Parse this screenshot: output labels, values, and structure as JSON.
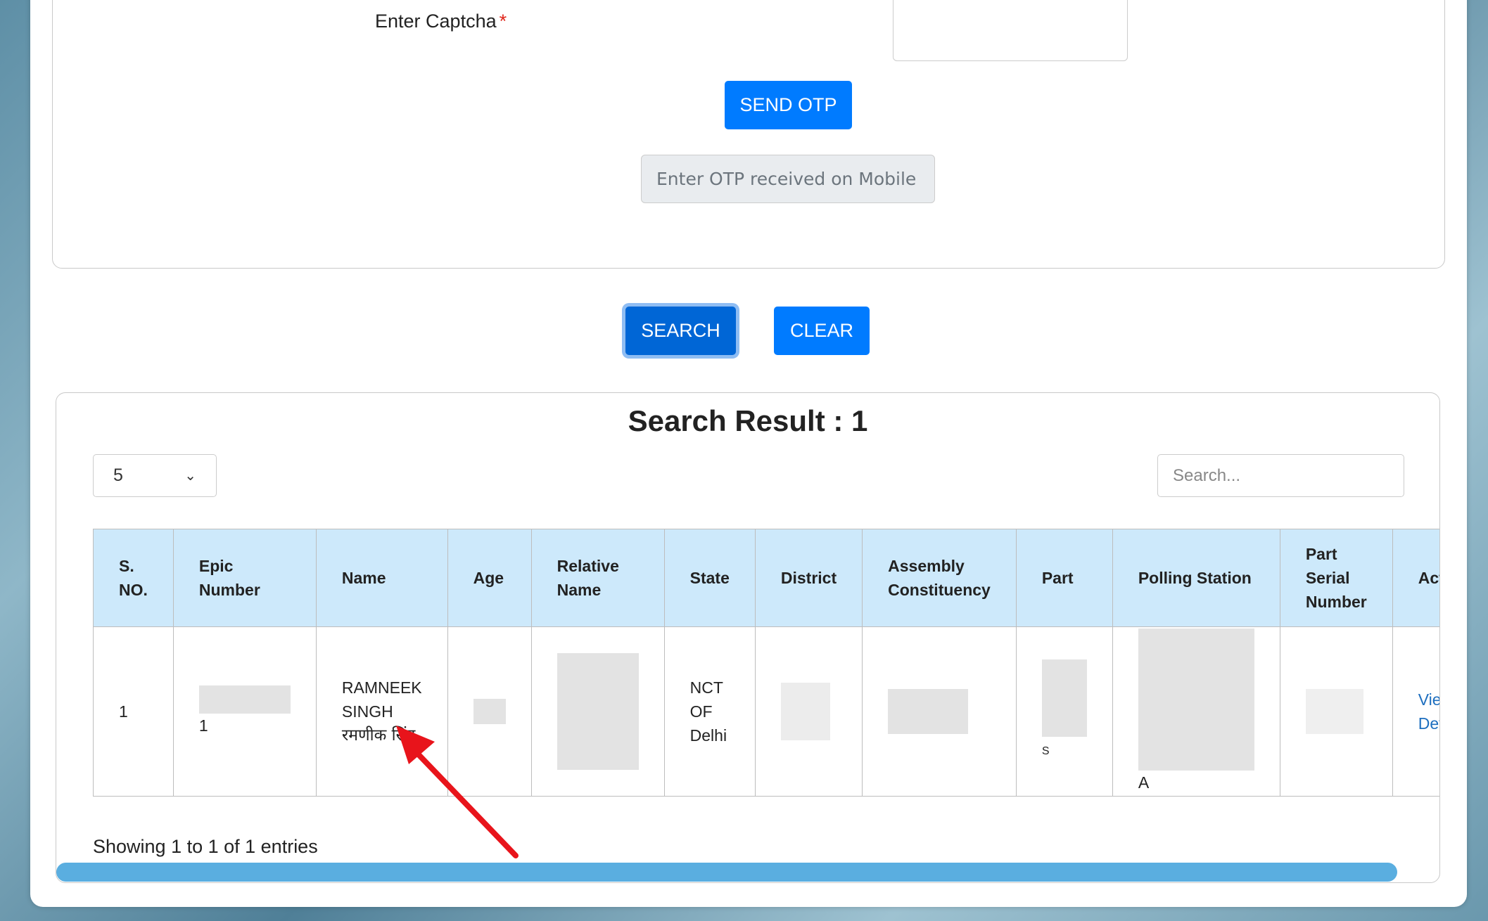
{
  "form": {
    "captcha_label": "Enter Captcha",
    "required_mark": "*",
    "send_otp_label": "SEND OTP",
    "otp_placeholder": "Enter OTP received on Mobile"
  },
  "actions": {
    "search_label": "SEARCH",
    "clear_label": "CLEAR"
  },
  "results": {
    "title": "Search Result : 1",
    "page_size": "5",
    "search_placeholder": "Search...",
    "columns": {
      "sno": "S. NO.",
      "epic": "Epic Number",
      "name": "Name",
      "age": "Age",
      "relative": "Relative Name",
      "state": "State",
      "district": "District",
      "assembly": "Assembly Constituency",
      "part": "Part",
      "polling": "Polling Station",
      "serial": "Part Serial Number",
      "action": "Action"
    },
    "row": {
      "sno": "1",
      "epic_visible": "1",
      "name_en": "RAMNEEK SINGH",
      "name_hi": "रमणीक सिंह",
      "state": "NCT OF Delhi",
      "part_visible": "S",
      "polling_visible": "A",
      "action_label": "View Details"
    },
    "footer": "Showing 1 to 1 of 1 entries"
  },
  "colors": {
    "primary": "#007bff",
    "header_bg": "#cde9fb",
    "scrollbar": "#5aaee0",
    "arrow": "#e8141b"
  }
}
